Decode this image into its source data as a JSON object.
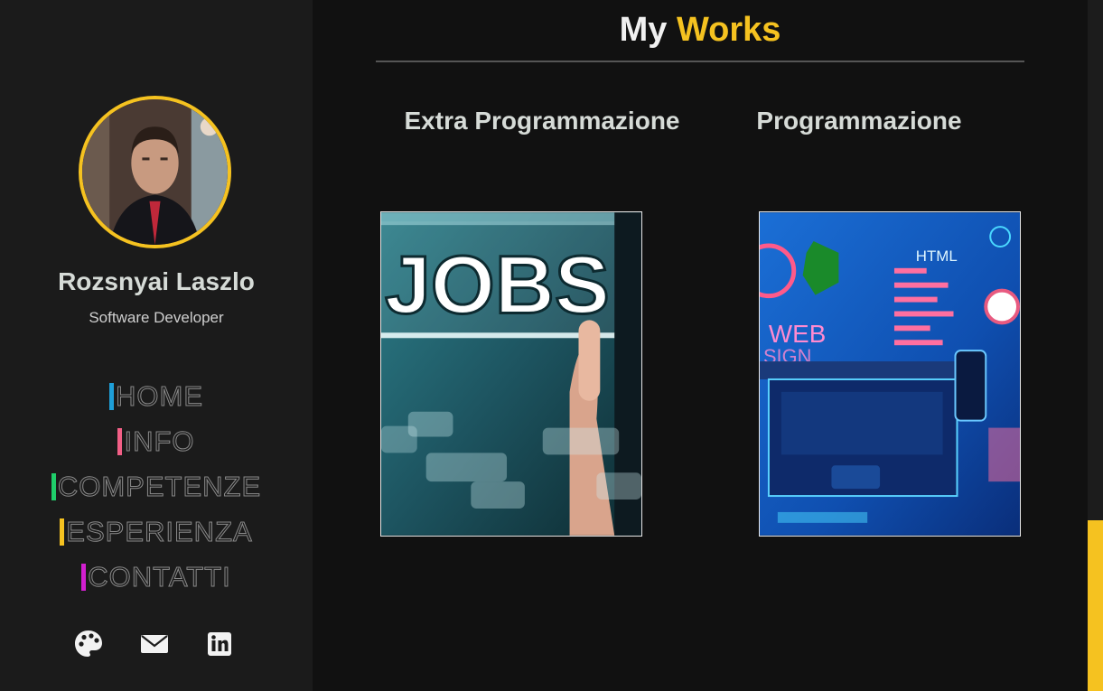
{
  "profile": {
    "name": "Rozsnyai Laszlo",
    "role": "Software Developer"
  },
  "nav": [
    {
      "label": "HOME",
      "color": "#1e9fd8"
    },
    {
      "label": "INFO",
      "color": "#f25f86"
    },
    {
      "label": "COMPETENZE",
      "color": "#1fce6a"
    },
    {
      "label": "ESPERIENZA",
      "color": "#f5c220"
    },
    {
      "label": "CONTATTI",
      "color": "#d21fd0"
    }
  ],
  "social": {
    "icons": [
      "palette-icon",
      "envelope-icon",
      "linkedin-icon"
    ]
  },
  "main": {
    "title_prefix": "My",
    "title_accent": "Works",
    "categories": [
      "Extra Programmazione",
      "Programmazione"
    ],
    "cards": [
      {
        "image_text": "JOBS"
      },
      {
        "image_text_1": "HTML",
        "image_text_2": "WEB",
        "image_text_3": "SIGN"
      }
    ]
  },
  "colors": {
    "accent": "#f5c220",
    "sidebar_bg": "#1b1b1b",
    "main_bg": "#111111"
  }
}
